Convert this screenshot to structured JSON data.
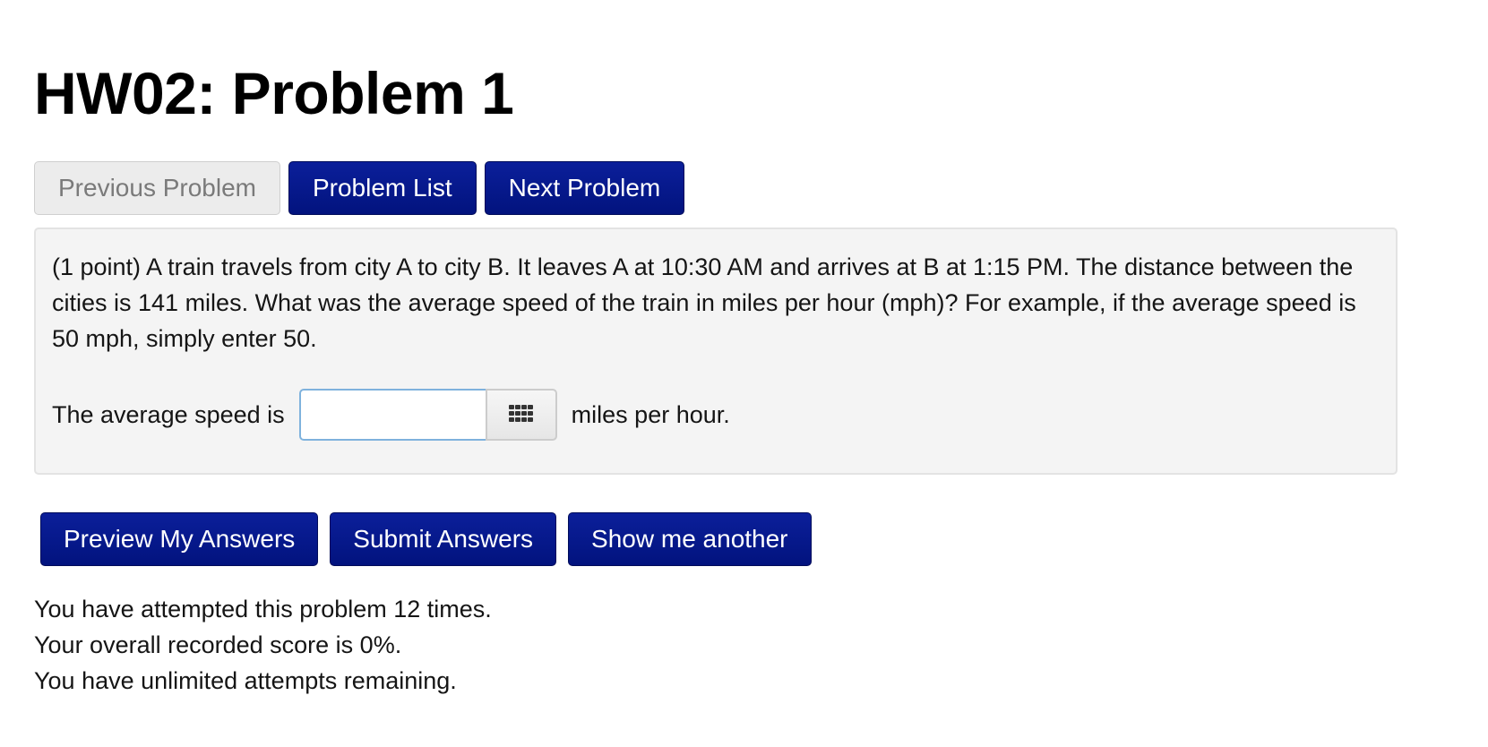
{
  "page": {
    "title": "HW02: Problem 1"
  },
  "nav": {
    "previous_label": "Previous Problem",
    "list_label": "Problem List",
    "next_label": "Next Problem"
  },
  "problem": {
    "text": "(1 point) A train travels from city A to city B. It leaves A at 10:30 AM and arrives at B at 1:15 PM. The distance between the cities is 141 miles. What was the average speed of the train in miles per hour (mph)? For example, if the average speed is 50 mph, simply enter 50.",
    "answer_prefix": "The average speed is",
    "answer_value": "",
    "answer_suffix": "miles per hour.",
    "keypad_icon": "keypad-grid-icon"
  },
  "actions": {
    "preview_label": "Preview My Answers",
    "submit_label": "Submit Answers",
    "another_label": "Show me another"
  },
  "status": {
    "attempts": "You have attempted this problem 12 times.",
    "score": "Your overall recorded score is 0%.",
    "remaining": "You have unlimited attempts remaining."
  },
  "colors": {
    "primary_button": "#02137e",
    "disabled_button": "#ececec",
    "panel_background": "#f4f4f4",
    "input_focus_border": "#7fb2dd"
  }
}
